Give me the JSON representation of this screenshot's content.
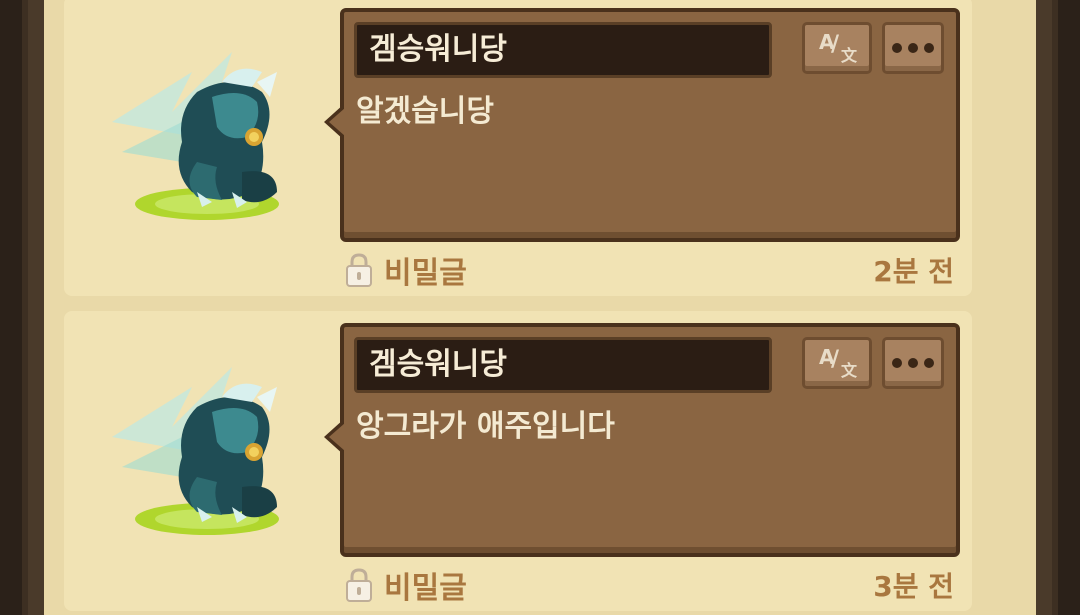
{
  "posts": [
    {
      "author": "겜승워니당",
      "message": "알겠습니당",
      "secret_label": "비밀글",
      "time": "2분 전"
    },
    {
      "author": "겜승워니당",
      "message": "앙그라가 애주입니다",
      "secret_label": "비밀글",
      "time": "3분 전"
    }
  ],
  "buttons": {
    "translate_icon": "translate-icon",
    "more_icon": "more-icon"
  },
  "colors": {
    "board": "#e9d9a8",
    "card": "#f1e3b4",
    "bubble": "#8a6542",
    "name_bar": "#2b1d14",
    "accent_text": "#a9773f"
  }
}
